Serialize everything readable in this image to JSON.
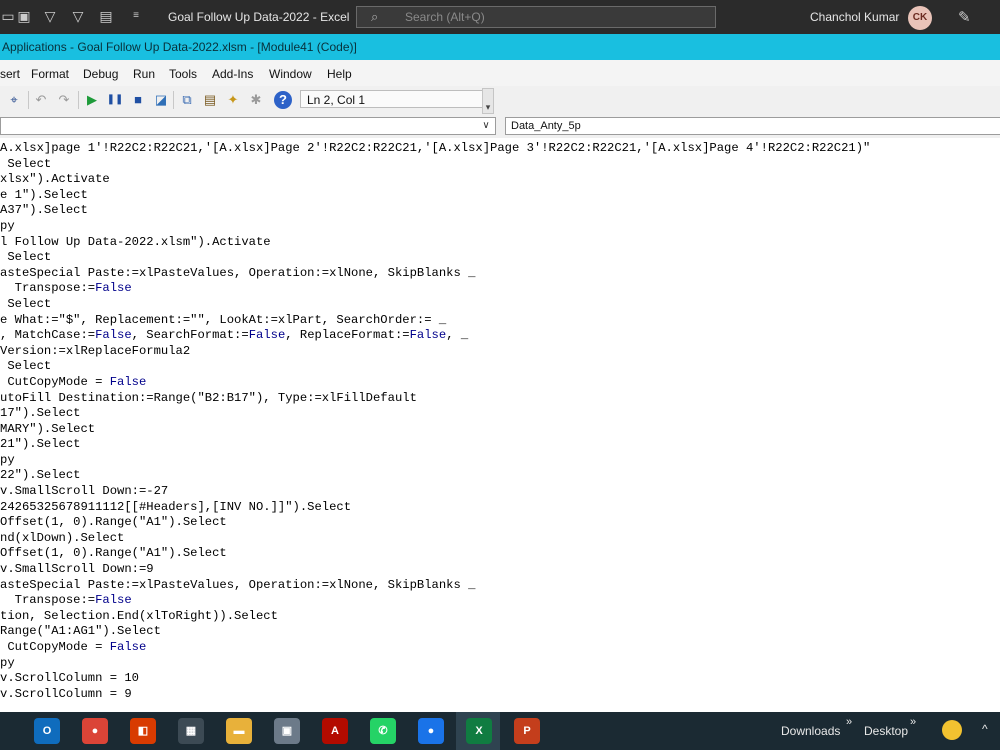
{
  "excel_bar": {
    "title": "Goal Follow Up Data-2022  -  Excel",
    "search_placeholder": "Search (Alt+Q)",
    "user_name": "Chanchol Kumar",
    "user_initials": "CK"
  },
  "vbe": {
    "title": "Applications - Goal Follow Up Data-2022.xlsm - [Module41 (Code)]",
    "menu": [
      "sert",
      "Format",
      "Debug",
      "Run",
      "Tools",
      "Add-Ins",
      "Window",
      "Help"
    ],
    "cursor_position": "Ln 2, Col 1",
    "procedure": "Data_Anty_5p"
  },
  "code": [
    [
      [
        "A.xlsx]page 1'!R22C2:R22C21,'[A.xlsx]Page 2'!R22C2:R22C21,'[A.xlsx]Page 3'!R22C2:R22C21,'[A.xlsx]Page 4'!R22C2:R22C21)\"",
        ""
      ]
    ],
    [
      [
        " Select",
        ""
      ]
    ],
    [
      [
        "xlsx\").Activate",
        ""
      ]
    ],
    [
      [
        "e 1\").Select",
        ""
      ]
    ],
    [
      [
        "A37\").Select",
        ""
      ]
    ],
    [
      [
        "py",
        ""
      ]
    ],
    [
      [
        "l Follow Up Data-2022.xlsm\").Activate",
        ""
      ]
    ],
    [
      [
        " Select",
        ""
      ]
    ],
    [
      [
        "asteSpecial Paste:=xlPasteValues, Operation:=xlNone, SkipBlanks _",
        ""
      ]
    ],
    [
      [
        "  Transpose:=",
        ""
      ],
      [
        "False",
        "kw"
      ]
    ],
    [
      [
        " Select",
        ""
      ]
    ],
    [
      [
        "e What:=\"$\", Replacement:=\"\", LookAt:=xlPart, SearchOrder:= _",
        ""
      ]
    ],
    [
      [
        ", MatchCase:=",
        ""
      ],
      [
        "False",
        "kw"
      ],
      [
        ", SearchFormat:=",
        ""
      ],
      [
        "False",
        "kw"
      ],
      [
        ", ReplaceFormat:=",
        ""
      ],
      [
        "False",
        "kw"
      ],
      [
        ", _",
        ""
      ]
    ],
    [
      [
        "Version:=xlReplaceFormula2",
        ""
      ]
    ],
    [
      [
        " Select",
        ""
      ]
    ],
    [
      [
        " CutCopyMode = ",
        ""
      ],
      [
        "False",
        "kw"
      ]
    ],
    [
      [
        "utoFill Destination:=Range(\"B2:B17\"), Type:=xlFillDefault",
        ""
      ]
    ],
    [
      [
        "17\").Select",
        ""
      ]
    ],
    [
      [
        "MARY\").Select",
        ""
      ]
    ],
    [
      [
        "21\").Select",
        ""
      ]
    ],
    [
      [
        "py",
        ""
      ]
    ],
    [
      [
        "22\").Select",
        ""
      ]
    ],
    [
      [
        "v.SmallScroll Down:=-27",
        ""
      ]
    ],
    [
      [
        "24265325678911112[[#Headers],[INV NO.]]\").Select",
        ""
      ]
    ],
    [
      [
        "Offset(1, 0).Range(\"A1\").Select",
        ""
      ]
    ],
    [
      [
        "nd(xlDown).Select",
        ""
      ]
    ],
    [
      [
        "Offset(1, 0).Range(\"A1\").Select",
        ""
      ]
    ],
    [
      [
        "v.SmallScroll Down:=9",
        ""
      ]
    ],
    [
      [
        "asteSpecial Paste:=xlPasteValues, Operation:=xlNone, SkipBlanks _",
        ""
      ]
    ],
    [
      [
        "  Transpose:=",
        ""
      ],
      [
        "False",
        "kw"
      ]
    ],
    [
      [
        "tion, Selection.End(xlToRight)).Select",
        ""
      ]
    ],
    [
      [
        "Range(\"A1:AG1\").Select",
        ""
      ]
    ],
    [
      [
        " CutCopyMode = ",
        ""
      ],
      [
        "False",
        "kw"
      ]
    ],
    [
      [
        "py",
        ""
      ]
    ],
    [
      [
        "v.ScrollColumn = 10",
        ""
      ]
    ],
    [
      [
        "v.ScrollColumn = 9",
        ""
      ]
    ]
  ],
  "taskbar": {
    "apps": [
      {
        "name": "outlook",
        "glyph": "O",
        "color": "#0f6cbd"
      },
      {
        "name": "chrome",
        "glyph": "●",
        "color": "#db4437"
      },
      {
        "name": "office",
        "glyph": "◧",
        "color": "#d83b01"
      },
      {
        "name": "calculator",
        "glyph": "▦",
        "color": "#3c4a54"
      },
      {
        "name": "file-explorer",
        "glyph": "▬",
        "color": "#e8b13a"
      },
      {
        "name": "teams-folder",
        "glyph": "▣",
        "color": "#6c7a89"
      },
      {
        "name": "acrobat",
        "glyph": "A",
        "color": "#b30b00"
      },
      {
        "name": "whatsapp",
        "glyph": "✆",
        "color": "#25d366"
      },
      {
        "name": "chrome-profile",
        "glyph": "●",
        "color": "#1a73e8"
      },
      {
        "name": "excel",
        "glyph": "X",
        "color": "#107c41"
      },
      {
        "name": "powerpoint",
        "glyph": "P",
        "color": "#c43e1c"
      }
    ],
    "downloads": "Downloads",
    "desktop": "Desktop"
  },
  "colors": {
    "vbe_title": "#19bfe0",
    "keyword": "#00008b",
    "taskbar": "#1b2a33"
  }
}
